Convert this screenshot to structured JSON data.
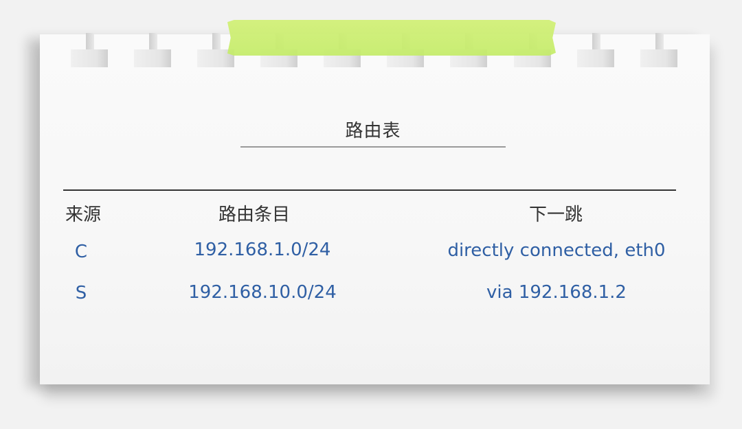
{
  "document": {
    "title": "路由表",
    "columns": [
      "来源",
      "路由条目",
      "下一跳"
    ],
    "rows": [
      {
        "source": "C",
        "route": "192.168.1.0/24",
        "next_hop": "directly connected, eth0"
      },
      {
        "source": "S",
        "route": "192.168.10.0/24",
        "next_hop": "via 192.168.1.2"
      }
    ]
  },
  "colors": {
    "text_header": "#333333",
    "text_data": "#2f5fa4",
    "tape": "#c8ec6c",
    "paper": "#f7f7f7"
  },
  "icons": {
    "decorations": [
      "binder-hole-icon",
      "tape-strip"
    ]
  }
}
